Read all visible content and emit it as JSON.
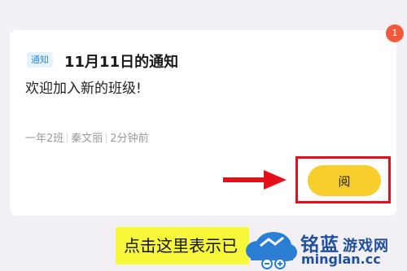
{
  "notification": {
    "unread_count": "1",
    "tag": "通知",
    "title": "11月11日的通知",
    "content": "欢迎加入新的班级!",
    "meta": {
      "class_name": "一年2班",
      "teacher": "秦文丽",
      "time": "2分钟前"
    },
    "read_button_label": "阅"
  },
  "caption": "点击这里表示已",
  "watermark": {
    "name": "铭蓝",
    "suffix": "游戏网",
    "domain": "minglan.cc"
  },
  "colors": {
    "accent_yellow": "#f8ce2c",
    "annotation_red": "#e3101a",
    "tag_blue": "#2e8de0",
    "badge_red": "#f15a3c"
  }
}
